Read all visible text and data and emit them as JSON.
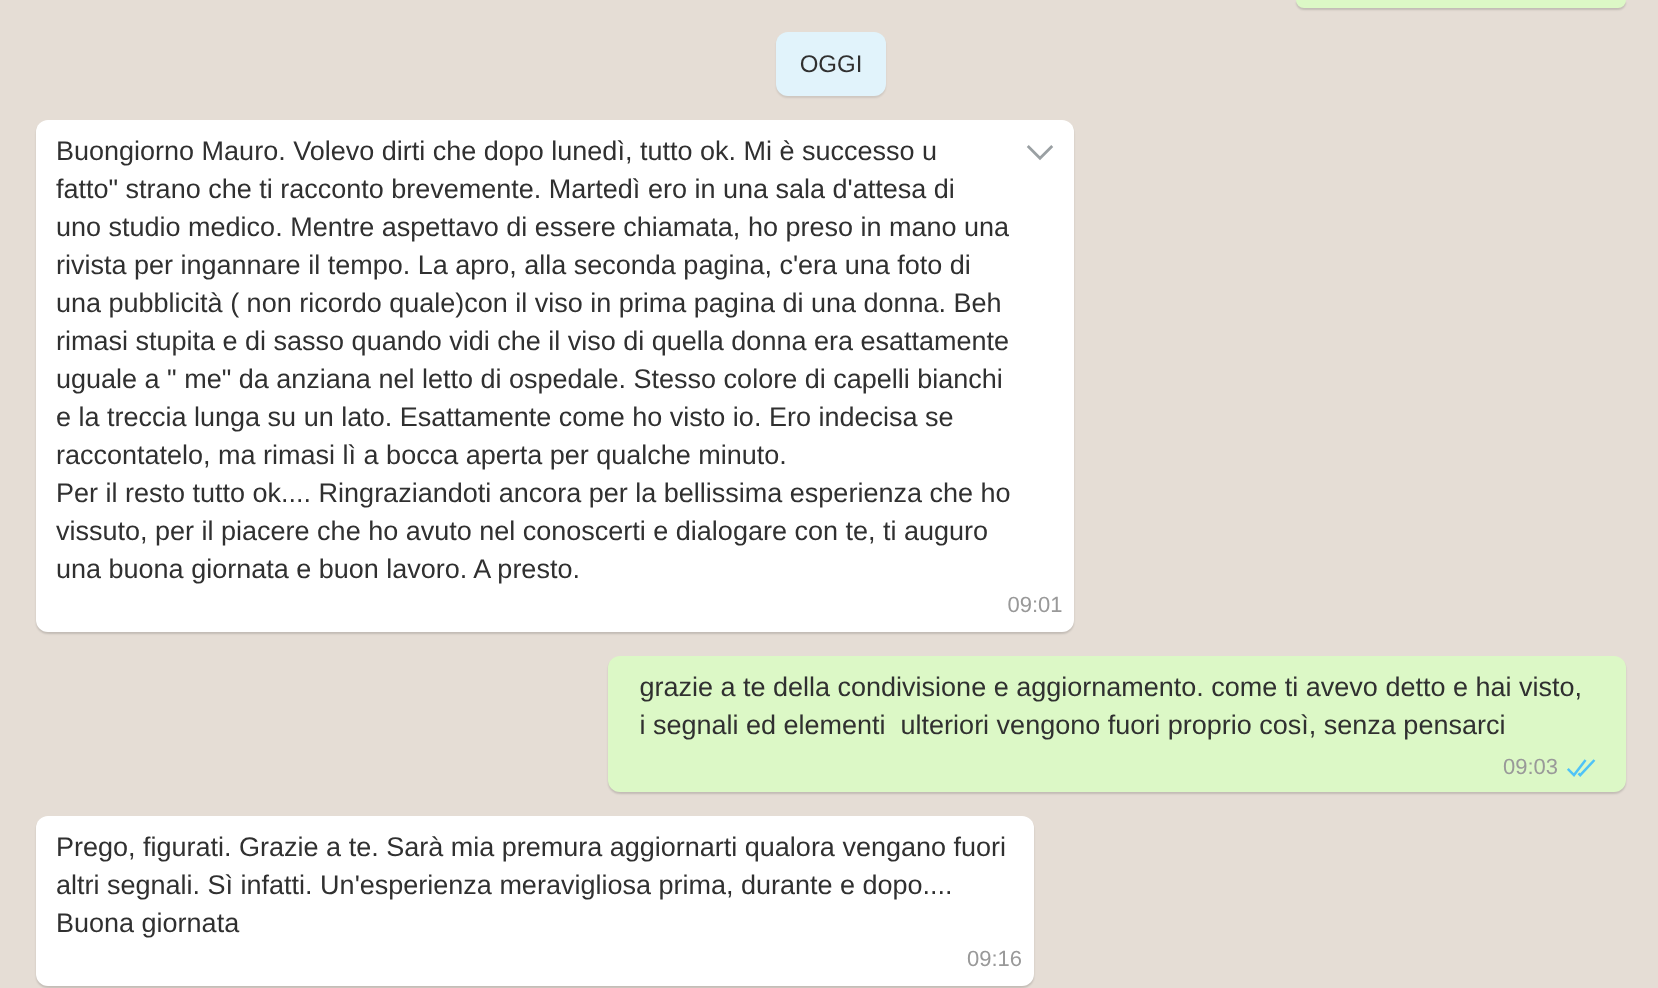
{
  "date_chip": "OGGI",
  "messages": [
    {
      "kind": "incoming",
      "menu_shown": true,
      "text": "Buongiorno Mauro. Volevo dirti che dopo lunedì, tutto ok. Mi è successo u\nfatto\" strano che ti racconto brevemente. Martedì ero in una sala d'attesa di\nuno studio medico. Mentre aspettavo di essere chiamata, ho preso in mano una\nrivista per ingannare il tempo. La apro, alla seconda pagina, c'era una foto di\nuna pubblicità ( non ricordo quale)con il viso in prima pagina di una donna. Beh\nrimasi stupita e di sasso quando vidi che il viso di quella donna era esattamente\nuguale a \" me\" da anziana nel letto di ospedale. Stesso colore di capelli bianchi\ne la treccia lunga su un lato. Esattamente come ho visto io. Ero indecisa se\nraccontatelo, ma rimasi lì a bocca aperta per qualche minuto.\nPer il resto tutto ok.... Ringraziandoti ancora per la bellissima esperienza che ho\nvissuto, per il piacere che ho avuto nel conoscerti e dialogare con te, ti auguro\nuna buona giornata e buon lavoro. A presto.",
      "time": "09:01"
    },
    {
      "kind": "outgoing",
      "read": true,
      "text": "grazie a te della condivisione e aggiornamento. come ti avevo detto e hai visto,\ni segnali ed elementi  ulteriori vengono fuori proprio così, senza pensarci",
      "time": "09:03"
    },
    {
      "kind": "incoming",
      "menu_shown": false,
      "text": "Prego, figurati. Grazie a te. Sarà mia premura aggiornarti qualora vengano fuori\naltri segnali. Sì infatti. Un'esperienza meravigliosa prima, durante e dopo....\nBuona giornata",
      "time": "09:16"
    }
  ]
}
